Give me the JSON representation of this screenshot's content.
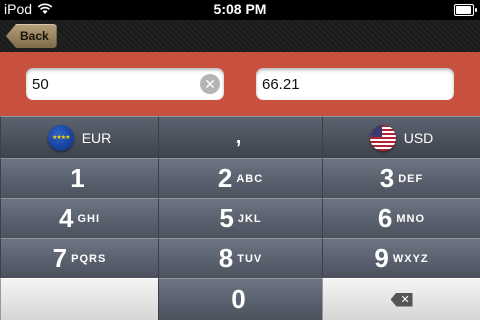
{
  "status_bar": {
    "carrier": "iPod",
    "time": "5:08 PM",
    "battery_level": 0.95
  },
  "nav_bar": {
    "back_label": "Back"
  },
  "inputs": {
    "from_value": "50",
    "to_value": "66.21"
  },
  "keypad": {
    "from_currency": {
      "code": "EUR",
      "flag": "eu-flag-icon"
    },
    "decimal_key": ",",
    "to_currency": {
      "code": "USD",
      "flag": "us-flag-icon"
    },
    "keys": [
      {
        "num": "1",
        "letters": ""
      },
      {
        "num": "2",
        "letters": "ABC"
      },
      {
        "num": "3",
        "letters": "DEF"
      },
      {
        "num": "4",
        "letters": "GHI"
      },
      {
        "num": "5",
        "letters": "JKL"
      },
      {
        "num": "6",
        "letters": "MNO"
      },
      {
        "num": "7",
        "letters": "PQRS"
      },
      {
        "num": "8",
        "letters": "TUV"
      },
      {
        "num": "9",
        "letters": "WXYZ"
      },
      {
        "num": "0",
        "letters": ""
      }
    ]
  }
}
